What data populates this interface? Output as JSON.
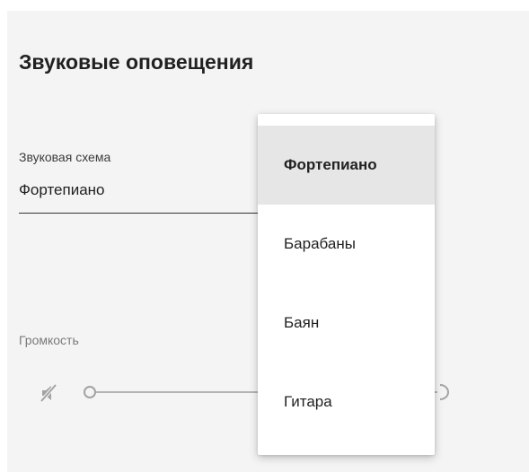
{
  "colors": {
    "panel_bg": "#f4f4f4",
    "selected_bg": "#e6e6e6",
    "text": "#212121",
    "muted_text": "#7a7a7a",
    "slider_track": "#b4b4b4"
  },
  "settings": {
    "title": "Звуковые оповещения",
    "sound_scheme": {
      "label": "Звуковая схема",
      "value": "Фортепиано"
    },
    "volume": {
      "label": "Громкость",
      "level": 0,
      "min_icon": "volume-muted-icon",
      "max_icon": "volume-max-icon"
    }
  },
  "dropdown": {
    "options": [
      {
        "label": "Фортепиано",
        "selected": true
      },
      {
        "label": "Барабаны",
        "selected": false
      },
      {
        "label": "Баян",
        "selected": false
      },
      {
        "label": "Гитара",
        "selected": false
      }
    ]
  }
}
